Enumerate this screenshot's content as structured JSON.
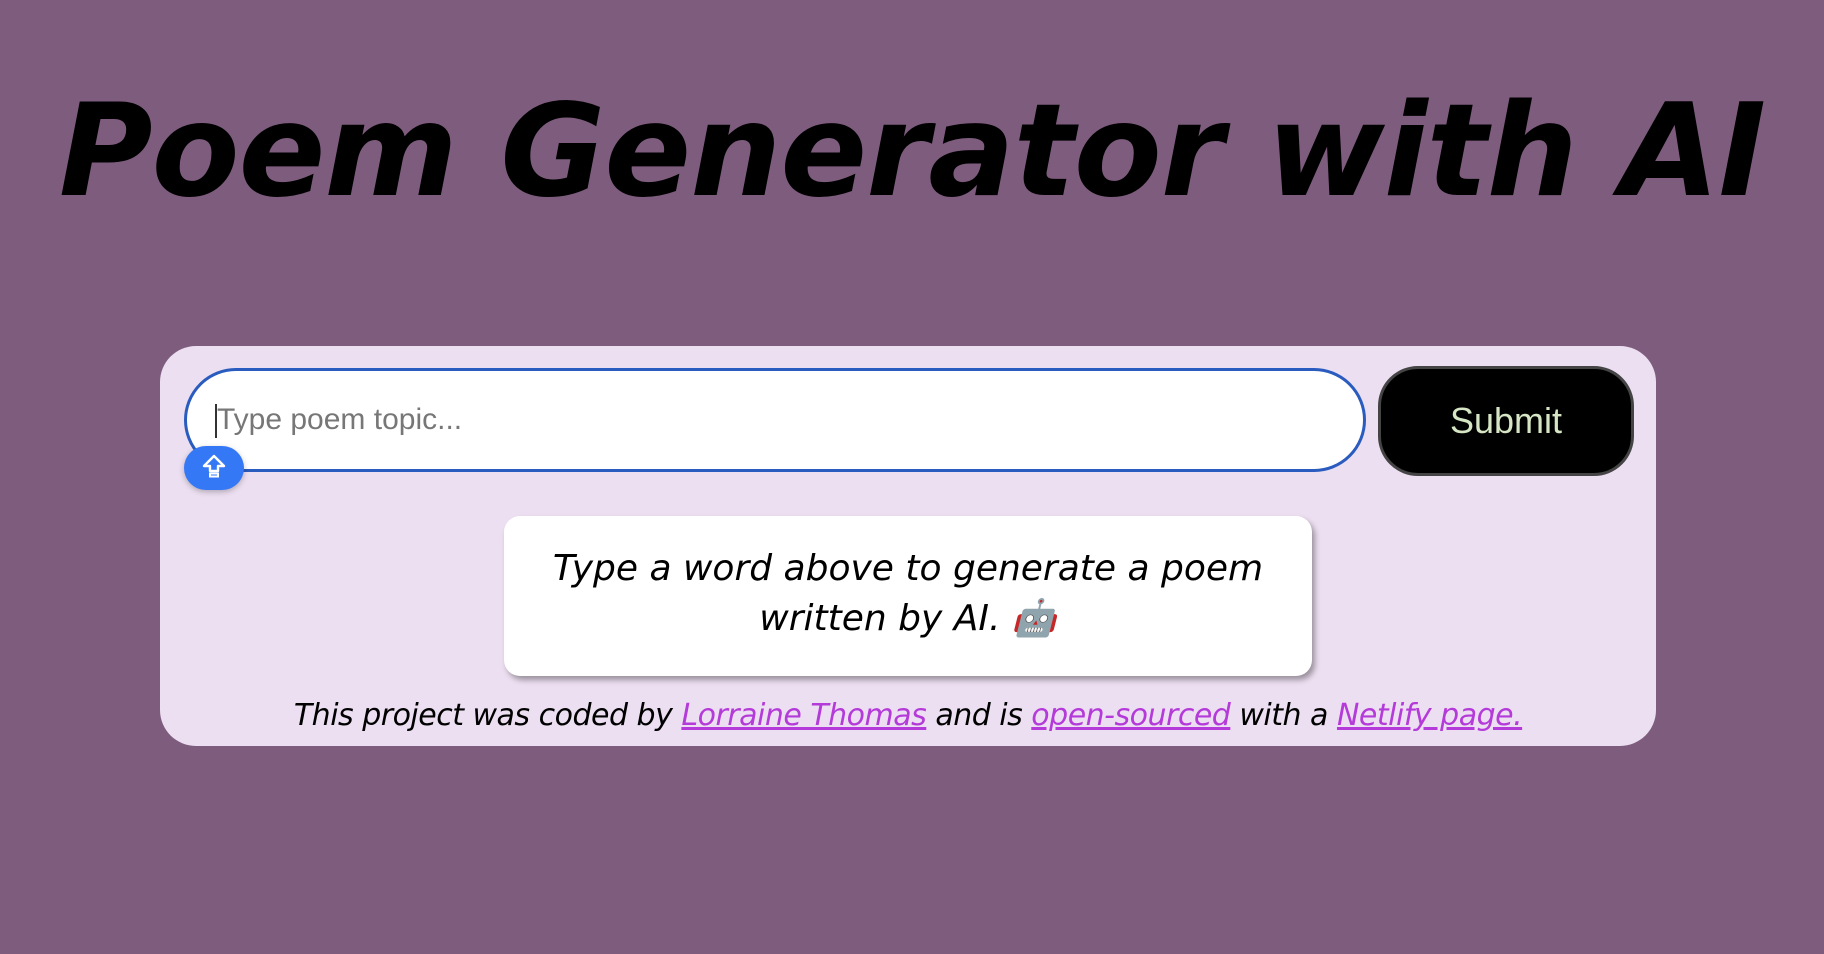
{
  "header": {
    "title": "Poem Generator with AI"
  },
  "form": {
    "input_placeholder": "Type poem topic...",
    "input_value": "",
    "submit_label": "Submit"
  },
  "output": {
    "message": "Type a word above to generate a poem written by AI. 🤖"
  },
  "footer": {
    "text_1": "This project was coded by ",
    "author_link": "Lorraine Thomas",
    "text_2": " and is ",
    "source_link": "open-sourced",
    "text_3": " with a ",
    "netlify_link": "Netlify page."
  },
  "colors": {
    "background": "#7e5c7e",
    "panel": "#ecdff1",
    "link": "#b43ad9",
    "submit_text": "#d6e6c4",
    "input_border": "#2a5bbf"
  },
  "icons": {
    "assist_badge": "upload-arrow-icon"
  }
}
